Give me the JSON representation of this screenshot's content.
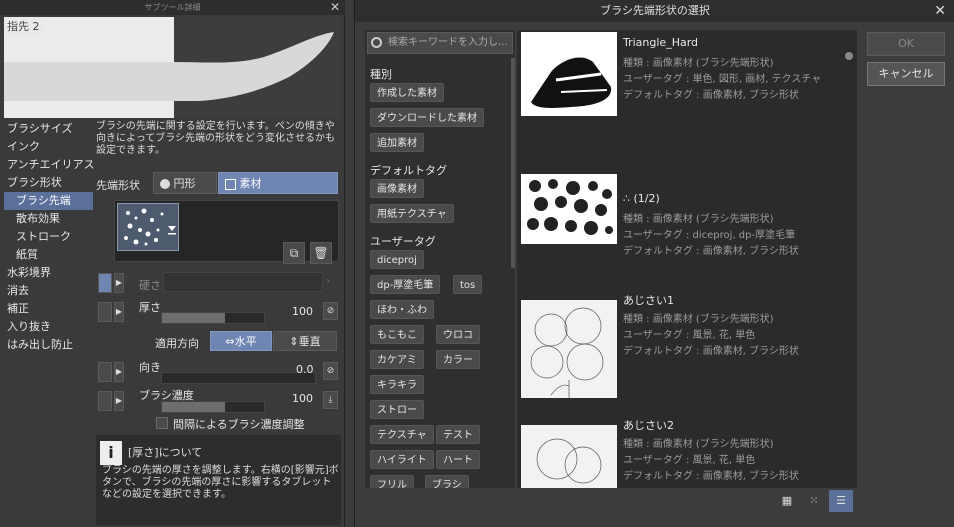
{
  "left_panel": {
    "title": "サブツール詳細",
    "preview_label": "指先 2",
    "categories": [
      "ブラシサイズ",
      "インク",
      "アンチエイリアス",
      "ブラシ形状",
      "ブラシ先端",
      "散布効果",
      "ストローク",
      "紙質",
      "水彩境界",
      "消去",
      "補正",
      "入り抜き",
      "はみ出し防止"
    ],
    "description": "ブラシの先端に関する設定を行います。ペンの傾きや向きによってブラシ先端の形状をどう変化させるかも設定できます。",
    "tip_shape_label": "先端形状",
    "tip_circle_label": "円形",
    "tip_material_label": "素材",
    "hardness_label": "硬さ",
    "thickness_label": "厚さ",
    "thickness_value": "100",
    "thickness_fill": 0.62,
    "apply_direction_label": "適用方向",
    "horizontal_label": "水平",
    "vertical_label": "垂直",
    "direction_label": "向き",
    "direction_value": "0.0",
    "density_label": "ブラシ濃度",
    "density_value": "100",
    "density_fill": 0.62,
    "interval_label": "間隔によるブラシ濃度調整",
    "info_title": "[厚さ]について",
    "info_text": "ブラシの先端の厚さを調整します。右横の[影響元]ボタンで、ブラシの先端の厚さに影響するタブレットなどの設定を選択できます。"
  },
  "dialog": {
    "title": "ブラシ先端形状の選択",
    "search_placeholder": "検索キーワードを入力し...",
    "ok_label": "OK",
    "cancel_label": "キャンセル",
    "section_kind": "種別",
    "section_default": "デフォルトタグ",
    "section_user": "ユーザータグ",
    "kind_tags": [
      "作成した素材",
      "ダウンロードした素材",
      "追加素材"
    ],
    "default_tags": [
      "画像素材",
      "用紙テクスチャ"
    ],
    "user_tags": [
      "diceproj",
      "dp-厚塗毛筆",
      "tos",
      "ほわ・ふわ",
      "もこもこ",
      "ウロコ",
      "カケアミ",
      "カラー",
      "キラキラ",
      "ストロー",
      "テクスチャ",
      "テスト",
      "ハイライト",
      "ハート",
      "フリル",
      "ブラシ"
    ],
    "items": [
      {
        "title": "Triangle_Hard",
        "kind": "種類 : 画像素材 (ブラシ先端形状)",
        "user_tag": "ユーザータグ : 単色, 図形, 画材, テクスチャ",
        "default_tag": "デフォルトタグ : 画像素材, ブラシ形状"
      },
      {
        "title": "∴ (1/2)",
        "kind": "種類 : 画像素材 (ブラシ先端形状)",
        "user_tag": "ユーザータグ : diceproj, dp-厚塗毛筆",
        "default_tag": "デフォルトタグ : 画像素材, ブラシ形状"
      },
      {
        "title": "あじさい1",
        "kind": "種類 : 画像素材 (ブラシ先端形状)",
        "user_tag": "ユーザータグ : 風景, 花, 単色",
        "default_tag": "デフォルトタグ : 画像素材, ブラシ形状"
      },
      {
        "title": "あじさい2",
        "kind": "種類 : 画像素材 (ブラシ先端形状)",
        "user_tag": "ユーザータグ : 風景, 花, 単色",
        "default_tag": "デフォルトタグ : 画像素材, ブラシ形状"
      }
    ]
  },
  "colors": {
    "accent": "#5a6f99",
    "panel": "#3a3a3a",
    "dark": "#2b2b2b"
  }
}
